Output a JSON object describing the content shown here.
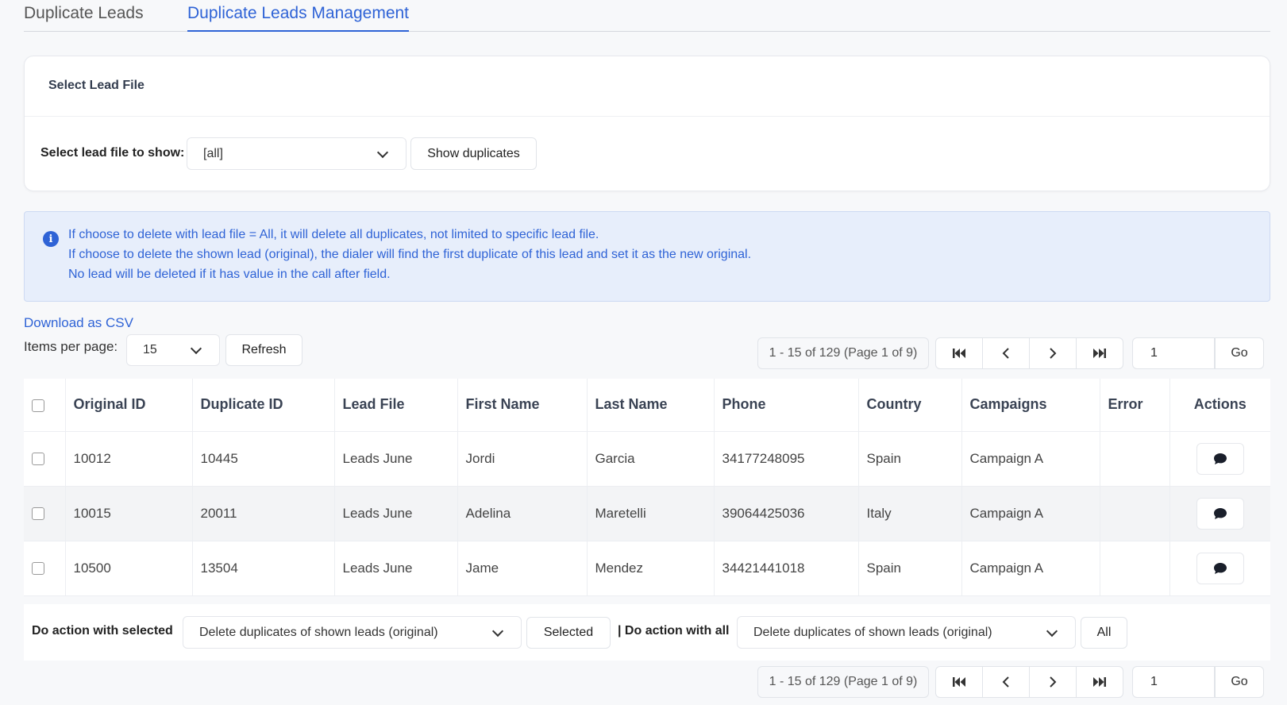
{
  "tabs": [
    {
      "label": "Duplicate Leads",
      "active": false
    },
    {
      "label": "Duplicate Leads Management",
      "active": true
    }
  ],
  "select_card": {
    "title": "Select Lead File",
    "label": "Select lead file to show:",
    "selected_file": "[all]",
    "show_button": "Show duplicates"
  },
  "info": {
    "lines": [
      "If choose to delete with lead file = All, it will delete all duplicates, not limited to specific lead file.",
      "If choose to delete the shown lead (original), the dialer will find the first duplicate of this lead and set it as the new original.",
      "No lead will be deleted if it has value in the call after field."
    ]
  },
  "toolbar": {
    "download_csv": "Download as CSV",
    "items_per_page_label": "Items per page:",
    "items_per_page_value": "15",
    "refresh": "Refresh"
  },
  "pager": {
    "summary": "1 - 15 of 129 (Page 1 of 9)",
    "page_value": "1",
    "go": "Go"
  },
  "table": {
    "columns": [
      "Original ID",
      "Duplicate ID",
      "Lead File",
      "First Name",
      "Last Name",
      "Phone",
      "Country",
      "Campaigns",
      "Error",
      "Actions"
    ],
    "rows": [
      [
        "10012",
        "10445",
        "Leads June",
        "Jordi",
        "Garcia",
        "34177248095",
        "Spain",
        "Campaign A",
        ""
      ],
      [
        "10015",
        "20011",
        "Leads June",
        "Adelina",
        "Maretelli",
        "39064425036",
        "Italy",
        "Campaign A",
        ""
      ],
      [
        "10500",
        "13504",
        "Leads June",
        "Jame",
        "Mendez",
        "34421441018",
        "Spain",
        "Campaign A",
        ""
      ]
    ]
  },
  "actions": {
    "selected_label": "Do action with selected",
    "selected_option": "Delete duplicates of shown leads (original)",
    "selected_button": "Selected",
    "all_label": "| Do action with all",
    "all_option": "Delete duplicates of shown leads (original)",
    "all_button": "All"
  },
  "colors": {
    "accent": "#2f63d6",
    "info_bg": "#e7eefb",
    "page_bg": "#f7f8fa"
  }
}
